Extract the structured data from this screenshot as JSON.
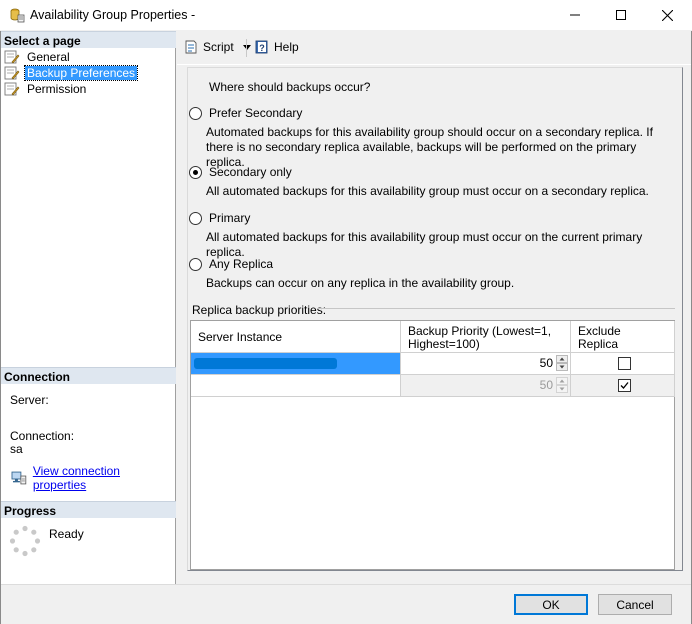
{
  "window": {
    "title": "Availability Group Properties -",
    "controls": {
      "minimize": "–",
      "maximize": "☐",
      "close": "✕"
    }
  },
  "sidebar": {
    "select_header": "Select a page",
    "pages": [
      {
        "label": "General",
        "selected": false
      },
      {
        "label": "Backup Preferences",
        "selected": true
      },
      {
        "label": "Permission",
        "selected": false
      }
    ],
    "connection_header": "Connection",
    "server_label": "Server:",
    "connection_label": "Connection:",
    "connection_value": "sa",
    "connection_link": "View connection properties",
    "progress_header": "Progress",
    "progress_status": "Ready"
  },
  "toolbar": {
    "script_label": "Script",
    "help_label": "Help"
  },
  "backup": {
    "question": "Where should backups occur?",
    "options": [
      {
        "label": "Prefer Secondary",
        "checked": false,
        "description": "Automated backups for this availability group should occur on a secondary replica. If there is no secondary replica available, backups will be performed on the primary replica."
      },
      {
        "label": "Secondary only",
        "checked": true,
        "description": "All automated backups for this availability group must occur on a secondary replica."
      },
      {
        "label": "Primary",
        "checked": false,
        "description": "All automated backups for this availability group must occur on the current primary replica."
      },
      {
        "label": "Any Replica",
        "checked": false,
        "description": "Backups can occur on any replica in the availability group."
      }
    ],
    "priorities_label": "Replica backup priorities:",
    "grid": {
      "headers": [
        "Server Instance",
        "Backup Priority (Lowest=1, Highest=100)",
        "Exclude Replica"
      ],
      "rows": [
        {
          "server": "",
          "priority": "50",
          "exclude": false,
          "selected": true
        },
        {
          "server": "",
          "priority": "50",
          "exclude": true,
          "selected": false
        }
      ]
    }
  },
  "footer": {
    "ok_label": "OK",
    "cancel_label": "Cancel"
  },
  "colors": {
    "accent": "#0078d7",
    "selection": "#3399ff",
    "header_bg": "#dfe7f0",
    "link": "#0000ee"
  }
}
